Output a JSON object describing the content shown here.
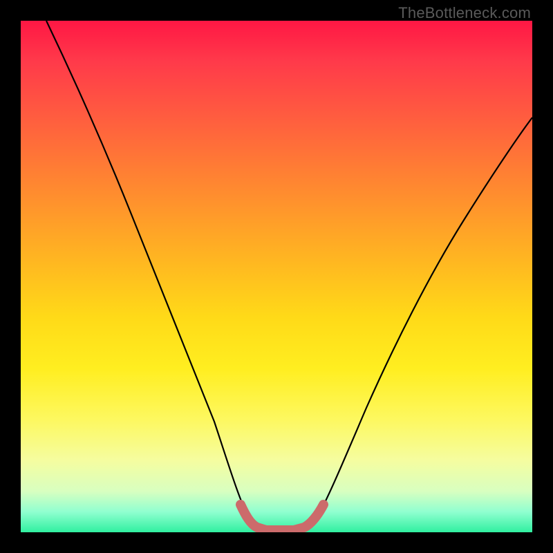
{
  "watermark": "TheBottleneck.com",
  "chart_data": {
    "type": "line",
    "title": "",
    "xlabel": "",
    "ylabel": "",
    "xlim": [
      0,
      100
    ],
    "ylim": [
      0,
      100
    ],
    "series": [
      {
        "name": "curve",
        "x": [
          5,
          10,
          15,
          20,
          25,
          30,
          35,
          40,
          43,
          45,
          48,
          52,
          55,
          58,
          62,
          68,
          74,
          80,
          86,
          92,
          98,
          100
        ],
        "y": [
          100,
          86,
          74,
          62,
          50,
          38,
          27,
          16,
          8,
          4,
          2,
          2,
          4,
          8,
          16,
          27,
          38,
          48,
          57,
          65,
          72,
          75
        ]
      }
    ],
    "highlight": {
      "name": "optimal-range",
      "color": "#cc6b6b",
      "x": [
        43,
        46,
        49,
        52,
        55,
        57
      ],
      "y": [
        6,
        3,
        2,
        2,
        3,
        6
      ]
    },
    "gradient": {
      "top_color": "#ff1744",
      "bottom_color": "#30f0a0",
      "meaning": "bottleneck-severity"
    }
  }
}
